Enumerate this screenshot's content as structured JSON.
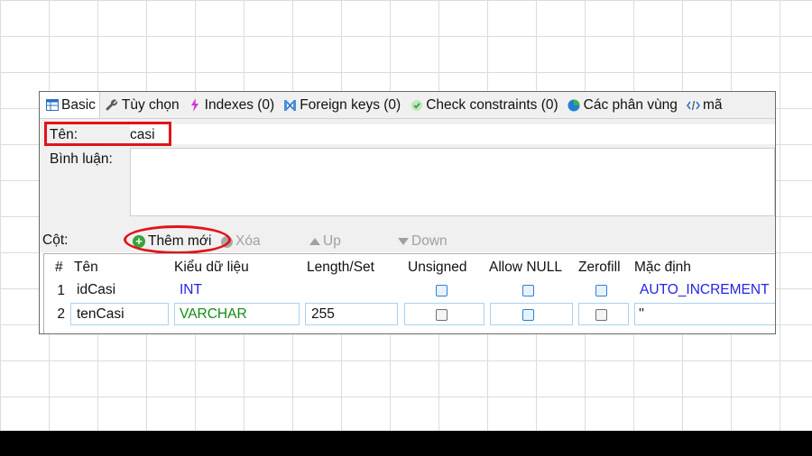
{
  "tabs": [
    {
      "label": "Basic",
      "icon": "table-icon"
    },
    {
      "label": "Tùy chọn",
      "icon": "wrench-icon"
    },
    {
      "label": "Indexes (0)",
      "icon": "lightning-icon"
    },
    {
      "label": "Foreign keys (0)",
      "icon": "foreign-key-icon"
    },
    {
      "label": "Check constraints (0)",
      "icon": "check-icon"
    },
    {
      "label": "Các phân vùng",
      "icon": "partition-icon"
    },
    {
      "label": "mã",
      "icon": "code-icon"
    }
  ],
  "form": {
    "name_label": "Tên:",
    "name_value": "casi",
    "comment_label": "Bình luận:",
    "comment_value": ""
  },
  "toolbar": {
    "columns_label": "Cột:",
    "add_label": "Thêm mới",
    "delete_label": "Xóa",
    "up_label": "Up",
    "down_label": "Down"
  },
  "columns_table": {
    "headers": [
      "#",
      "Tên",
      "Kiểu dữ liệu",
      "Length/Set",
      "Unsigned",
      "Allow NULL",
      "Zerofill",
      "Mặc định"
    ],
    "rows": [
      {
        "num": "1",
        "name": "idCasi",
        "type": "INT",
        "length": "",
        "unsigned": false,
        "allow_null": false,
        "zerofill": false,
        "default": "AUTO_INCREMENT"
      },
      {
        "num": "2",
        "name": "tenCasi",
        "type": "VARCHAR",
        "length": "255",
        "unsigned": false,
        "allow_null": false,
        "zerofill": false,
        "default": "''"
      }
    ]
  },
  "colors": {
    "highlight_red": "#e0141a",
    "type_int_blue": "#2323e8",
    "type_varchar_green": "#128a12",
    "add_green": "#3aa23a"
  }
}
